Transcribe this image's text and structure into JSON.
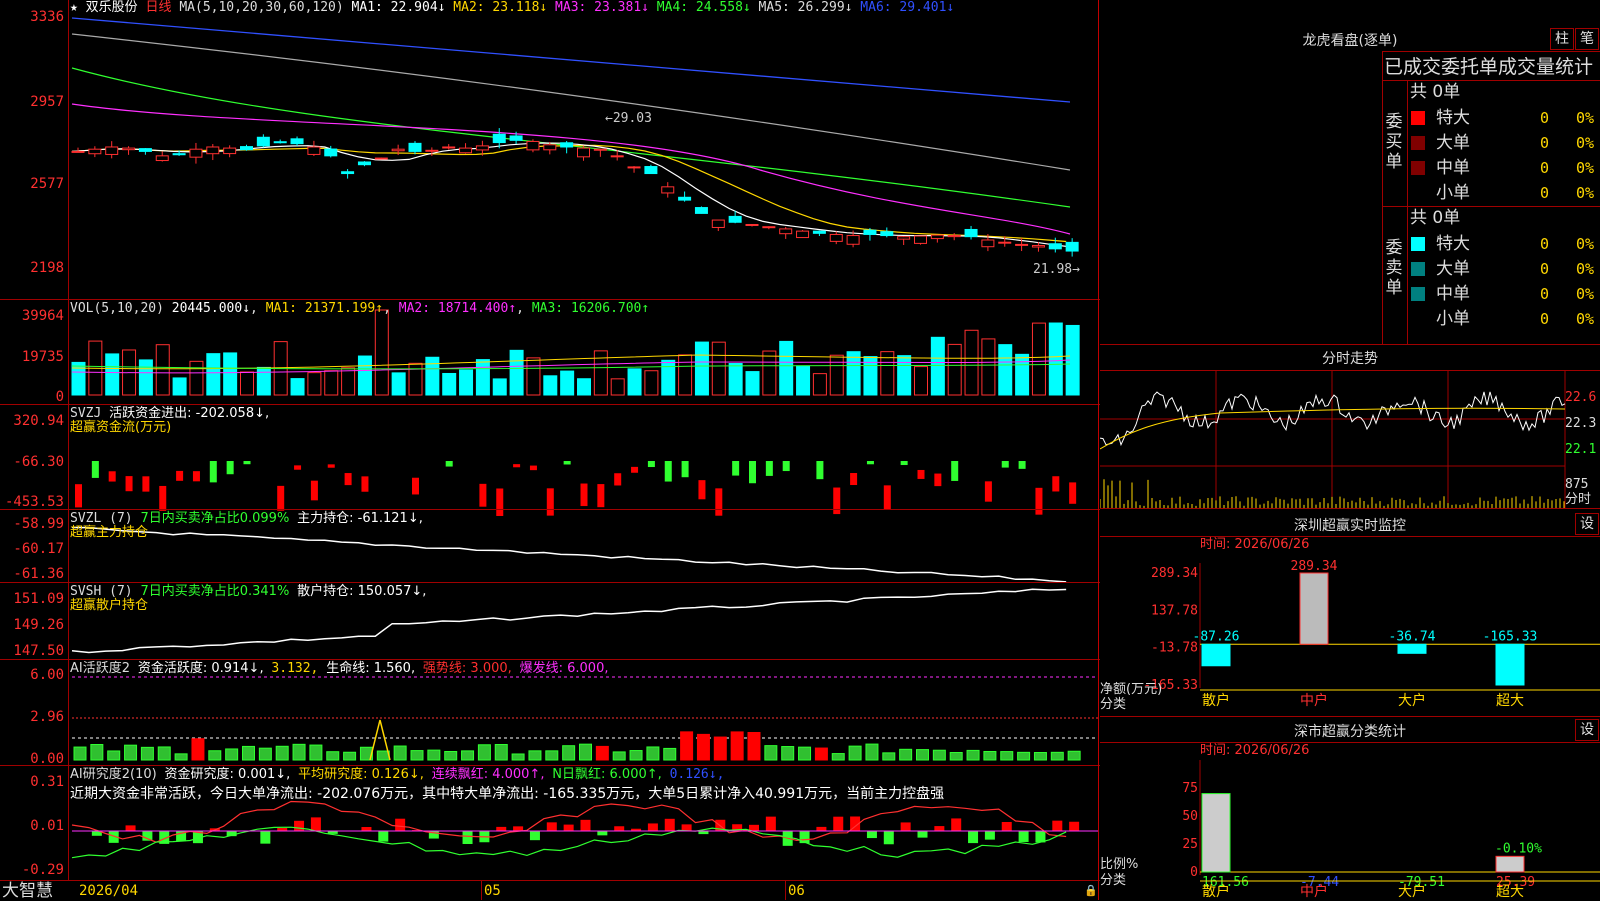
{
  "stock": {
    "name": "双乐股份",
    "period": "日线"
  },
  "main": {
    "ma_header": "MA(5,10,20,30,60,120)",
    "ma1": "MA1: 22.904↓",
    "ma2": "MA2: 23.118↓",
    "ma3": "MA3: 23.381↓",
    "ma4": "MA4: 24.558↓",
    "ma5": "MA5: 26.299↓",
    "ma6": "MA6: 29.401↓",
    "y_labels": [
      "3336",
      "2957",
      "2577",
      "2198"
    ],
    "high_note": "←29.03",
    "low_note": "21.98→"
  },
  "vol": {
    "header": "VOL(5,10,20)",
    "value": "20445.000↓",
    "ma1": "MA1: 21371.199↑",
    "ma2": "MA2: 18714.400↑",
    "ma3": "MA3: 16206.700↑",
    "y_labels": [
      "39964",
      "19735",
      "0"
    ]
  },
  "svzj": {
    "header": "SVZJ",
    "text": "活跃资金进出: -202.058↓,",
    "sub": "超赢资金流(万元)",
    "y_labels": [
      "320.94",
      "-66.30",
      "-453.53"
    ]
  },
  "svzl": {
    "header": "SVZL (7)",
    "text1": "7日内买卖净占比0.099%",
    "text2": "主力持仓: -61.121↓,",
    "sub": "超赢主力持仓",
    "y_labels": [
      "-58.99",
      "-60.17",
      "-61.36"
    ]
  },
  "svsh": {
    "header": "SVSH (7)",
    "text1": "7日内买卖净占比0.341%",
    "text2": "散户持仓: 150.057↓,",
    "sub": "超赢散户持仓",
    "y_labels": [
      "151.09",
      "149.26",
      "147.50"
    ]
  },
  "ai1": {
    "header": "AI活跃度2",
    "t1": "资金活跃度: 0.914↓,",
    "t2": "3.132,",
    "t3": "生命线: 1.560,",
    "t4": "强势线: 3.000,",
    "t5": "爆发线: 6.000,",
    "y_labels": [
      "6.00",
      "2.96",
      "0.00"
    ]
  },
  "ai2": {
    "header": "AI研究度2(10)",
    "t1": "资金研究度: 0.001↓,",
    "t2": "平均研究度: 0.126↓,",
    "t3": "连续飘红: 4.000↑,",
    "t4": "N日飘红: 6.000↑,",
    "t5": "0.126↓,",
    "summary": "近期大资金非常活跃，今日大单净流出: -202.076万元，其中特大单净流出: -165.335万元，大单5日累计净入40.991万元，当前主力控盘强",
    "y_labels": [
      "0.31",
      "0.01",
      "-0.29"
    ]
  },
  "date_axis": {
    "brand": "大智慧",
    "start": "2026/04",
    "m1": "05",
    "m2": "06"
  },
  "longhu": {
    "title": "龙虎看盘(逐单)",
    "btn1": "柱",
    "btn2": "笔",
    "header": "已成交委托单成交量统计",
    "buy_label": "委买单",
    "sell_label": "委卖单",
    "buy_total": "共 0单",
    "sell_total": "共 0单",
    "rows_buy": [
      {
        "name": "特大",
        "v": "0",
        "p": "0%"
      },
      {
        "name": "大单",
        "v": "0",
        "p": "0%"
      },
      {
        "name": "中单",
        "v": "0",
        "p": "0%"
      },
      {
        "name": "小单",
        "v": "0",
        "p": "0%"
      }
    ],
    "rows_sell": [
      {
        "name": "特大",
        "v": "0",
        "p": "0%"
      },
      {
        "name": "大单",
        "v": "0",
        "p": "0%"
      },
      {
        "name": "中单",
        "v": "0",
        "p": "0%"
      },
      {
        "name": "小单",
        "v": "0",
        "p": "0%"
      }
    ]
  },
  "intraday": {
    "title": "分时走势",
    "y_labels": [
      "22.6",
      "22.3",
      "22.1"
    ],
    "vol_label": "875",
    "unit": "分时"
  },
  "sz_monitor": {
    "title": "深圳超赢实时监控",
    "btn": "设",
    "date": "时间: 2026/06/26",
    "y_labels": [
      "289.34",
      "137.78",
      "-13.78",
      "-165.33"
    ],
    "yl1": "净额(万元)",
    "yl2": "分类",
    "cats": [
      "散户",
      "中户",
      "大户",
      "超大"
    ],
    "values": [
      -87.26,
      289.34,
      -36.74,
      -165.33
    ],
    "value_labels": [
      "-87.26",
      "289.34",
      "-36.74",
      "-165.33"
    ]
  },
  "sz_class": {
    "title": "深市超赢分类统计",
    "btn": "设",
    "date": "时间: 2026/06/26",
    "y_labels": [
      "75",
      "50",
      "25",
      "0"
    ],
    "yl1": "比例%",
    "yl2": "分类",
    "cats": [
      "散户",
      "中户",
      "大户",
      "超大"
    ],
    "note": "-0.10%",
    "value_labels": [
      "161.56",
      "-7.44",
      "-79.51",
      "25.39"
    ]
  }
}
